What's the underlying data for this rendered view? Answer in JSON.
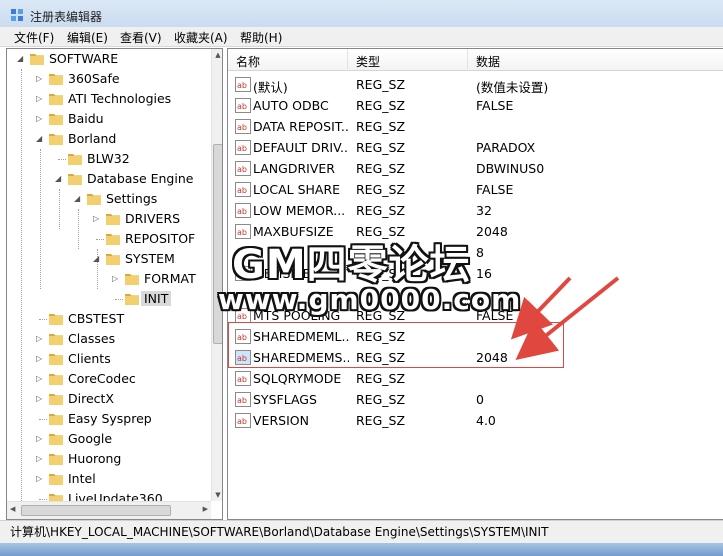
{
  "window": {
    "title": "注册表编辑器"
  },
  "menu": [
    "文件(F)",
    "编辑(E)",
    "查看(V)",
    "收藏夹(A)",
    "帮助(H)"
  ],
  "tree": {
    "items": [
      {
        "label": "SOFTWARE",
        "state": "expanded"
      },
      {
        "label": "360Safe",
        "state": "collapsed"
      },
      {
        "label": "ATI Technologies",
        "state": "collapsed"
      },
      {
        "label": "Baidu",
        "state": "collapsed"
      },
      {
        "label": "Borland",
        "state": "expanded"
      },
      {
        "label": "BLW32",
        "state": "leaf"
      },
      {
        "label": "Database Engine",
        "state": "expanded"
      },
      {
        "label": "Settings",
        "state": "expanded"
      },
      {
        "label": "DRIVERS",
        "state": "collapsed"
      },
      {
        "label": "REPOSITOF",
        "state": "leaf"
      },
      {
        "label": "SYSTEM",
        "state": "expanded"
      },
      {
        "label": "FORMAT",
        "state": "collapsed"
      },
      {
        "label": "INIT",
        "state": "selected"
      },
      {
        "label": "CBSTEST",
        "state": "leaf"
      },
      {
        "label": "Classes",
        "state": "collapsed"
      },
      {
        "label": "Clients",
        "state": "collapsed"
      },
      {
        "label": "CoreCodec",
        "state": "collapsed"
      },
      {
        "label": "DirectX",
        "state": "collapsed"
      },
      {
        "label": "Easy Sysprep",
        "state": "leaf"
      },
      {
        "label": "Google",
        "state": "collapsed"
      },
      {
        "label": "Huorong",
        "state": "collapsed"
      },
      {
        "label": "Intel",
        "state": "collapsed"
      },
      {
        "label": "LiveUpdate360",
        "state": "leaf"
      }
    ]
  },
  "list": {
    "columns": [
      "名称",
      "类型",
      "数据"
    ],
    "rows": [
      {
        "name": "(默认)",
        "type": "REG_SZ",
        "data": "(数值未设置)"
      },
      {
        "name": "AUTO ODBC",
        "type": "REG_SZ",
        "data": "FALSE"
      },
      {
        "name": "DATA REPOSIT...",
        "type": "REG_SZ",
        "data": ""
      },
      {
        "name": "DEFAULT DRIV...",
        "type": "REG_SZ",
        "data": "PARADOX"
      },
      {
        "name": "LANGDRIVER",
        "type": "REG_SZ",
        "data": "DBWINUS0"
      },
      {
        "name": "LOCAL SHARE",
        "type": "REG_SZ",
        "data": "FALSE"
      },
      {
        "name": "LOW MEMOR...",
        "type": "REG_SZ",
        "data": "32"
      },
      {
        "name": "MAXBUFSIZE",
        "type": "REG_SZ",
        "data": "2048"
      },
      {
        "name": "",
        "type": "",
        "data": "8"
      },
      {
        "name": "MEMSIZE",
        "type": "REG_SZ",
        "data": "16"
      },
      {
        "name": "",
        "type": "",
        "data": ""
      },
      {
        "name": "MTS POOLING",
        "type": "REG_SZ",
        "data": "FALSE"
      },
      {
        "name": "SHAREDMEML...",
        "type": "REG_SZ",
        "data": ""
      },
      {
        "name": "SHAREDMEMS...",
        "type": "REG_SZ",
        "data": "2048"
      },
      {
        "name": "SQLQRYMODE",
        "type": "REG_SZ",
        "data": ""
      },
      {
        "name": "SYSFLAGS",
        "type": "REG_SZ",
        "data": "0"
      },
      {
        "name": "VERSION",
        "type": "REG_SZ",
        "data": "4.0"
      }
    ]
  },
  "status": {
    "path": "计算机\\HKEY_LOCAL_MACHINE\\SOFTWARE\\Borland\\Database Engine\\Settings\\SYSTEM\\INIT"
  },
  "watermark": {
    "title": "GM四零论坛",
    "url": "www.gm0000.com"
  },
  "colors": {
    "folder": "#e9c266",
    "selection": "#d9d9d9",
    "annotation": "#e0473f"
  }
}
